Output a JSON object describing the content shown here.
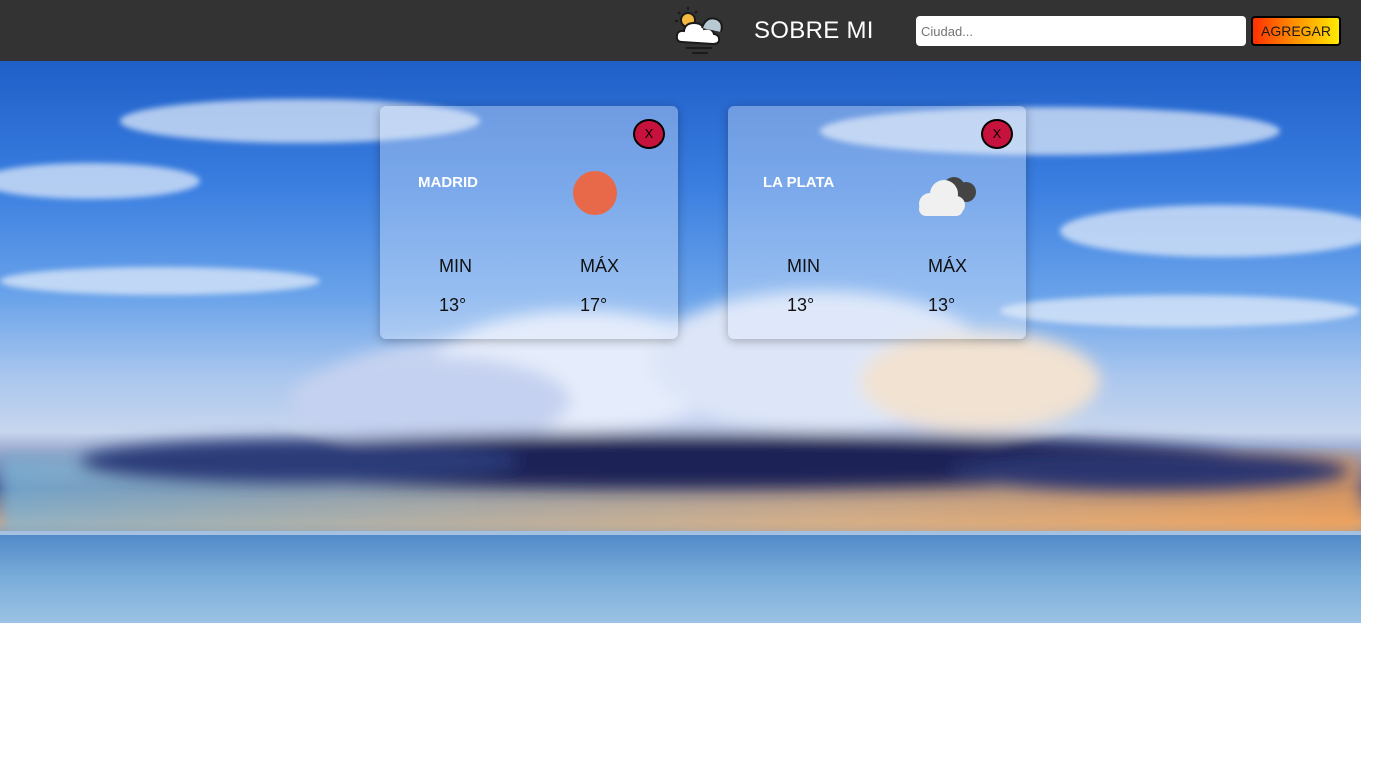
{
  "navbar": {
    "logo_icon": "sun-cloud-wind-icon",
    "link_label": "SOBRE MI",
    "search": {
      "placeholder": "Ciudad...",
      "value": ""
    },
    "add_button_label": "AGREGAR"
  },
  "cards": [
    {
      "city": "MADRID",
      "icon": "sun-icon",
      "close_label": "X",
      "min_label": "MIN",
      "max_label": "MÁX",
      "min_value": "13°",
      "max_value": "17°"
    },
    {
      "city": "LA PLATA",
      "icon": "broken-clouds-icon",
      "close_label": "X",
      "min_label": "MIN",
      "max_label": "MÁX",
      "min_value": "13°",
      "max_value": "13°"
    }
  ],
  "colors": {
    "navbar": "#333333",
    "close_button": "#c8123e",
    "sun": "#e8694a"
  }
}
